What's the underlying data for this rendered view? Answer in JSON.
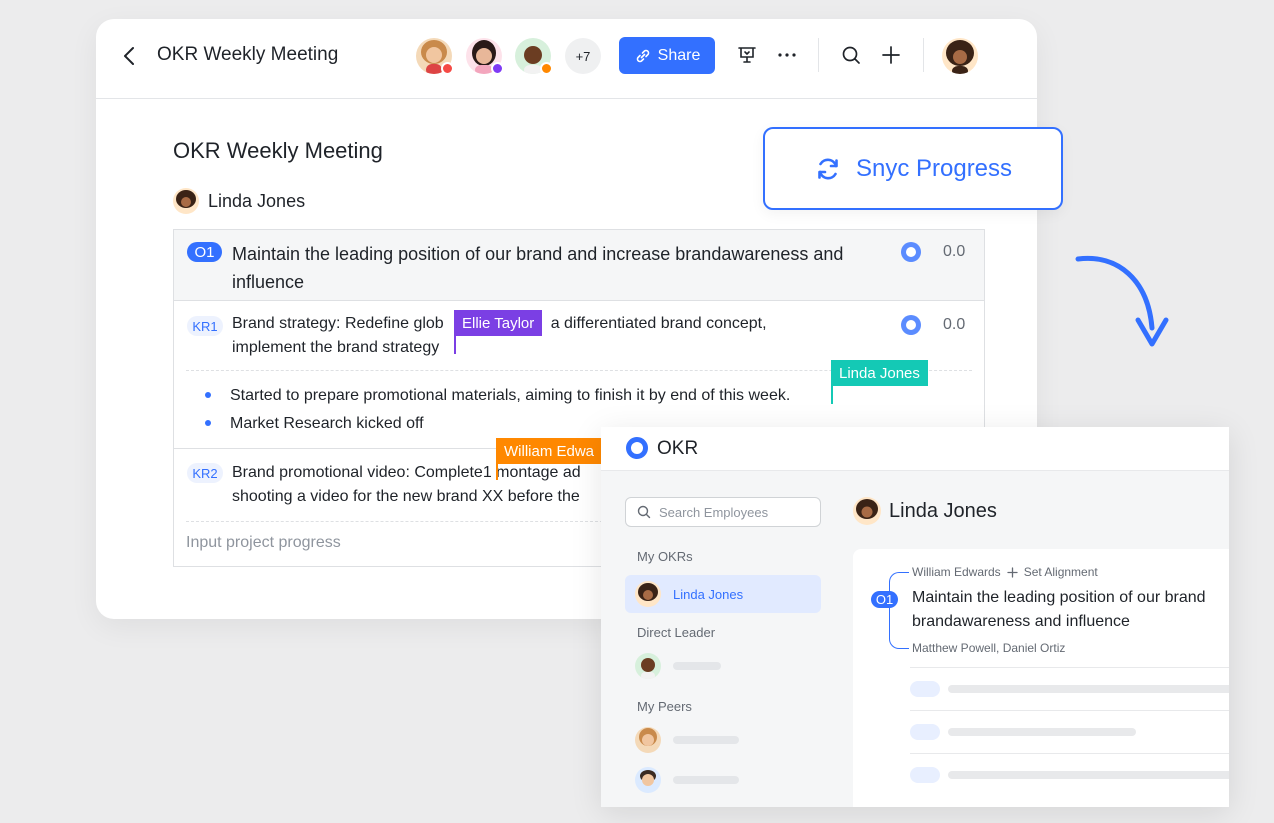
{
  "doc": {
    "title": "OKR Weekly Meeting",
    "heading": "OKR Weekly Meeting",
    "collaborators_more": "+7",
    "share_label": "Share",
    "owner_name": "Linda Jones",
    "objective": {
      "badge": "O1",
      "text": "Maintain the leading position of our brand and increase brandawareness and influence",
      "progress": "0.0"
    },
    "kr1": {
      "badge": "KR1",
      "text_before": "Brand strategy: Redefine glob",
      "text_after": "a differentiated brand concept, implement the brand strategy",
      "progress": "0.0"
    },
    "bullets": [
      "Started to prepare promotional materials, aiming to finish it by end of this week.",
      "Market Research kicked off"
    ],
    "kr2": {
      "badge": "KR2",
      "text_line1_before": "Brand promotional video: Complete",
      "text_line1_after": "1 montage ad",
      "text_line2": "shooting a video for the new brand XX before the"
    },
    "input_placeholder": "Input project progress"
  },
  "cursors": {
    "ellie": "Ellie Taylor",
    "linda": "Linda Jones",
    "william": "William Edwa"
  },
  "sync": {
    "label": "Snyc Progress"
  },
  "okr_app": {
    "title": "OKR",
    "search_placeholder": "Search Employees",
    "my_okrs_label": "My OKRs",
    "active_person": "Linda Jones",
    "direct_leader_label": "Direct Leader",
    "my_peers_label": "My Peers",
    "person_name": "Linda Jones",
    "aligned_from": "William Edwards",
    "set_alignment": "Set Alignment",
    "objective_badge": "O1",
    "objective_text": "Maintain the leading position of our brand brandawareness and influence",
    "aligned_by": "Matthew Powell, Daniel Ortiz"
  },
  "colors": {
    "accent": "#3370ff",
    "ellie_cursor": "#7b3fe4",
    "linda_cursor": "#14c9b5",
    "william_cursor": "#ff8800",
    "status_red": "#f54a45",
    "status_purple": "#7f3bf5",
    "status_orange": "#ff8800"
  }
}
